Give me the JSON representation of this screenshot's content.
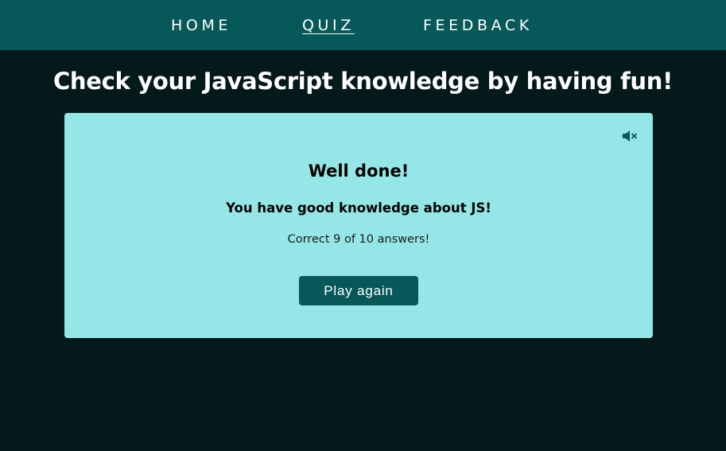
{
  "nav": {
    "home": "HOME",
    "quiz": "QUIZ",
    "feedback": "FEEDBACK",
    "active": "quiz"
  },
  "page": {
    "title": "Check your JavaScript knowledge by having fun!"
  },
  "result": {
    "heading": "Well done!",
    "message": "You have good knowledge about JS!",
    "score_text": "Correct 9 of 10 answers!",
    "correct": 9,
    "total": 10,
    "play_again_label": "Play again"
  },
  "icons": {
    "sound": "sound-muted-icon"
  },
  "colors": {
    "background": "#04191a",
    "navbar": "#075859",
    "card": "#95e6e6",
    "button": "#075859",
    "text_light": "#ffffff",
    "text_dark": "#000000"
  }
}
